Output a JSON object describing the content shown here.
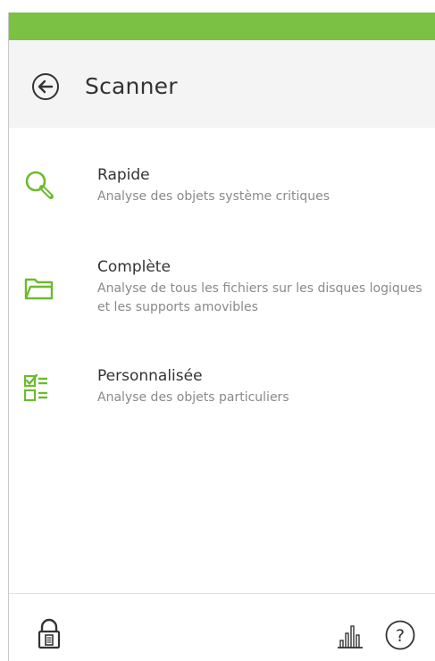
{
  "colors": {
    "accent": "#7bc143",
    "icon_green": "#6cbb2e",
    "header_bg": "#f4f4f4",
    "title_text": "#333333",
    "desc_text": "#8a8a8a"
  },
  "header": {
    "back_icon": "back-arrow-circle-icon",
    "title": "Scanner"
  },
  "scan_options": [
    {
      "icon": "magnifier-icon",
      "title": "Rapide",
      "description": "Analyse des objets système critiques"
    },
    {
      "icon": "folder-icon",
      "title": "Complète",
      "description": "Analyse de tous les fichiers sur les disques logiques et les supports amovibles"
    },
    {
      "icon": "checklist-icon",
      "title": "Personnalisée",
      "description": "Analyse des objets particuliers"
    }
  ],
  "footer": {
    "lock_icon": "padlock-icon",
    "stats_icon": "bar-chart-icon",
    "help_icon": "help-circle-icon",
    "help_glyph": "?"
  }
}
